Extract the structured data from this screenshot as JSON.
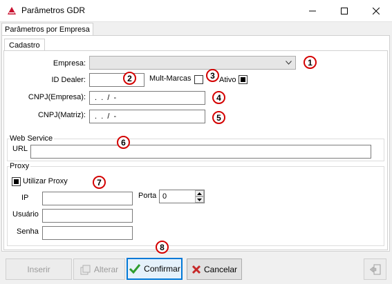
{
  "window": {
    "title": "Parâmetros GDR"
  },
  "tabs": {
    "outer": "Parâmetros por Empresa",
    "inner": "Cadastro"
  },
  "form": {
    "empresa_label": "Empresa:",
    "empresa_value": "",
    "id_dealer_label": "ID Dealer:",
    "id_dealer_value": "",
    "mult_marcas_label": "Mult-Marcas",
    "mult_marcas_checked": false,
    "ativo_label": "Ativo",
    "ativo_checked": true,
    "cnpj_empresa_label": "CNPJ(Empresa):",
    "cnpj_empresa_value": " .  .  /  -",
    "cnpj_matriz_label": "CNPJ(Matriz):",
    "cnpj_matriz_value": " .  .  /  -"
  },
  "web_service": {
    "title": "Web Service",
    "url_label": "URL",
    "url_value": ""
  },
  "proxy": {
    "title": "Proxy",
    "utilizar_label": "Utilizar Proxy",
    "utilizar_checked": true,
    "ip_label": "IP",
    "ip_value": "",
    "porta_label": "Porta",
    "porta_value": "0",
    "usuario_label": "Usuário",
    "usuario_value": "",
    "senha_label": "Senha",
    "senha_value": ""
  },
  "badges": [
    "1",
    "2",
    "3",
    "4",
    "5",
    "6",
    "7",
    "8"
  ],
  "toolbar": {
    "inserir": "Inserir",
    "alterar": "Alterar",
    "confirmar": "Confirmar",
    "cancelar": "Cancelar"
  },
  "colors": {
    "badge_border": "#d40000",
    "confirm_check": "#2e9d2e",
    "cancel_x": "#c62828",
    "focus_border": "#0078d7"
  }
}
